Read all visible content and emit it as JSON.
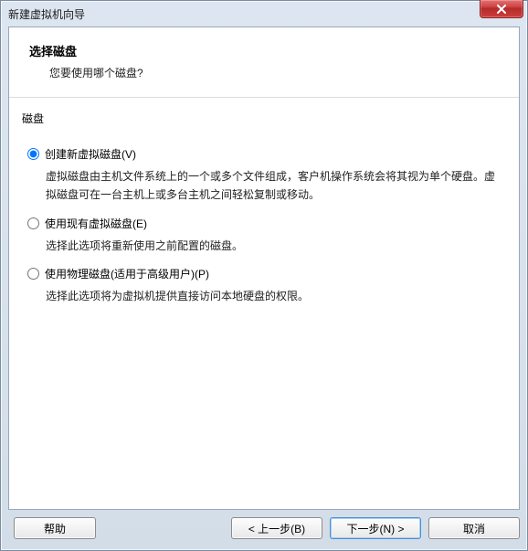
{
  "window": {
    "title": "新建虚拟机向导"
  },
  "header": {
    "title": "选择磁盘",
    "subtitle": "您要使用哪个磁盘?"
  },
  "section": {
    "label": "磁盘"
  },
  "options": {
    "create": {
      "label": "创建新虚拟磁盘(V)",
      "desc": "虚拟磁盘由主机文件系统上的一个或多个文件组成，客户机操作系统会将其视为单个硬盘。虚拟磁盘可在一台主机上或多台主机之间轻松复制或移动。",
      "selected": true
    },
    "existing": {
      "label": "使用现有虚拟磁盘(E)",
      "desc": "选择此选项将重新使用之前配置的磁盘。",
      "selected": false
    },
    "physical": {
      "label": "使用物理磁盘(适用于高级用户)(P)",
      "desc": "选择此选项将为虚拟机提供直接访问本地硬盘的权限。",
      "selected": false
    }
  },
  "buttons": {
    "help": "帮助",
    "back": "< 上一步(B)",
    "next": "下一步(N) >",
    "cancel": "取消"
  }
}
